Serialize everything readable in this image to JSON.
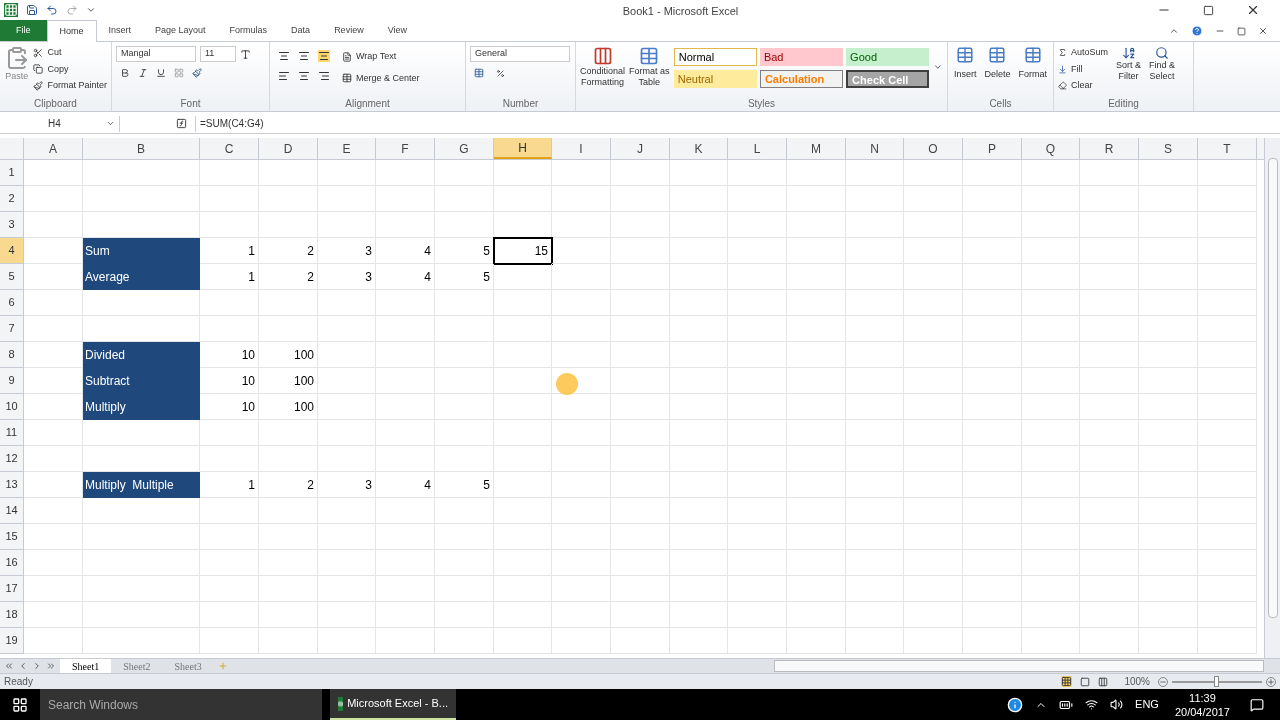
{
  "window": {
    "title": "Book1  -  Microsoft Excel"
  },
  "tabs": [
    {
      "label": "File",
      "kind": "file",
      "selected": false
    },
    {
      "label": "Home",
      "kind": "tab",
      "selected": true
    },
    {
      "label": "Insert",
      "kind": "tab",
      "selected": false
    },
    {
      "label": "Page Layout",
      "kind": "tab",
      "selected": false
    },
    {
      "label": "Formulas",
      "kind": "tab",
      "selected": false
    },
    {
      "label": "Data",
      "kind": "tab",
      "selected": false
    },
    {
      "label": "Review",
      "kind": "tab",
      "selected": false
    },
    {
      "label": "View",
      "kind": "tab",
      "selected": false
    }
  ],
  "ribbon": {
    "clipboard": {
      "label": "Clipboard",
      "paste": "Paste",
      "cut": "Cut",
      "copy": "Copy",
      "format_painter": "Format Painter"
    },
    "font": {
      "label": "Font",
      "font_name": "Mangal",
      "font_size": "11"
    },
    "alignment": {
      "label": "Alignment",
      "wrap_text": "Wrap Text",
      "merge_center": "Merge & Center"
    },
    "number": {
      "label": "Number",
      "format": "General"
    },
    "styles": {
      "label": "Styles",
      "conditional": [
        "Conditional",
        "Formatting"
      ],
      "format_as_table": [
        "Format as",
        "Table"
      ],
      "gallery": [
        {
          "text": "Normal",
          "kind": "normal"
        },
        {
          "text": "Bad",
          "kind": "bad"
        },
        {
          "text": "Good",
          "kind": "good"
        },
        {
          "text": "Neutral",
          "kind": "neutral"
        },
        {
          "text": "Calculation",
          "kind": "calculation"
        },
        {
          "text": "Check Cell",
          "kind": "check"
        }
      ]
    },
    "cells": {
      "label": "Cells",
      "buttons": [
        "Insert",
        "Delete",
        "Format"
      ]
    },
    "editing": {
      "label": "Editing",
      "autosum": "AutoSum",
      "fill": "Fill",
      "clear": "Clear",
      "sort": [
        "Sort &",
        "Filter"
      ],
      "find": [
        "Find &",
        "Select"
      ]
    }
  },
  "formula_bar": {
    "name_box": "H4",
    "formula": "=SUM(C4:G4)"
  },
  "columns": [
    {
      "label": "A",
      "selected": false
    },
    {
      "label": "B",
      "selected": false
    },
    {
      "label": "C",
      "selected": false
    },
    {
      "label": "D",
      "selected": false
    },
    {
      "label": "E",
      "selected": false
    },
    {
      "label": "F",
      "selected": false
    },
    {
      "label": "G",
      "selected": false
    },
    {
      "label": "H",
      "selected": true
    },
    {
      "label": "I",
      "selected": false
    },
    {
      "label": "J",
      "selected": false
    },
    {
      "label": "K",
      "selected": false
    },
    {
      "label": "L",
      "selected": false
    },
    {
      "label": "M",
      "selected": false
    },
    {
      "label": "N",
      "selected": false
    },
    {
      "label": "O",
      "selected": false
    },
    {
      "label": "P",
      "selected": false
    },
    {
      "label": "Q",
      "selected": false
    },
    {
      "label": "R",
      "selected": false
    },
    {
      "label": "S",
      "selected": false
    },
    {
      "label": "T",
      "selected": false
    }
  ],
  "rows": [
    {
      "header": "1",
      "selected": false
    },
    {
      "header": "2",
      "selected": false
    },
    {
      "header": "3",
      "selected": false
    },
    {
      "header": "4",
      "selected": true,
      "label": "Sum",
      "values": [
        "1",
        "2",
        "3",
        "4",
        "5",
        "15"
      ]
    },
    {
      "header": "5",
      "selected": false,
      "label": "Average",
      "values": [
        "1",
        "2",
        "3",
        "4",
        "5"
      ]
    },
    {
      "header": "6",
      "selected": false
    },
    {
      "header": "7",
      "selected": false
    },
    {
      "header": "8",
      "selected": false,
      "label": "Divided",
      "values": [
        "10",
        "100"
      ]
    },
    {
      "header": "9",
      "selected": false,
      "label": "Subtract",
      "values": [
        "10",
        "100"
      ]
    },
    {
      "header": "10",
      "selected": false,
      "label": "Multiply",
      "values": [
        "10",
        "100"
      ]
    },
    {
      "header": "11",
      "selected": false
    },
    {
      "header": "12",
      "selected": false
    },
    {
      "header": "13",
      "selected": false,
      "label": "Multiply  Multiple",
      "values": [
        "1",
        "2",
        "3",
        "4",
        "5"
      ]
    },
    {
      "header": "14",
      "selected": false
    },
    {
      "header": "15",
      "selected": false
    },
    {
      "header": "16",
      "selected": false
    },
    {
      "header": "17",
      "selected": false
    },
    {
      "header": "18",
      "selected": false
    },
    {
      "header": "19",
      "selected": false
    }
  ],
  "sheet_tabs": [
    {
      "label": "Sheet1",
      "selected": true
    },
    {
      "label": "Sheet2",
      "selected": false
    },
    {
      "label": "Sheet3",
      "selected": false
    }
  ],
  "status_bar": {
    "status": "Ready",
    "zoom": "100%",
    "zoom_level": {
      "level": 0.5
    }
  },
  "taskbar": {
    "search_placeholder": "Search Windows",
    "app": "Microsoft Excel - B...",
    "language": "ENG",
    "time": "11:39",
    "date": "20/04/2017"
  }
}
